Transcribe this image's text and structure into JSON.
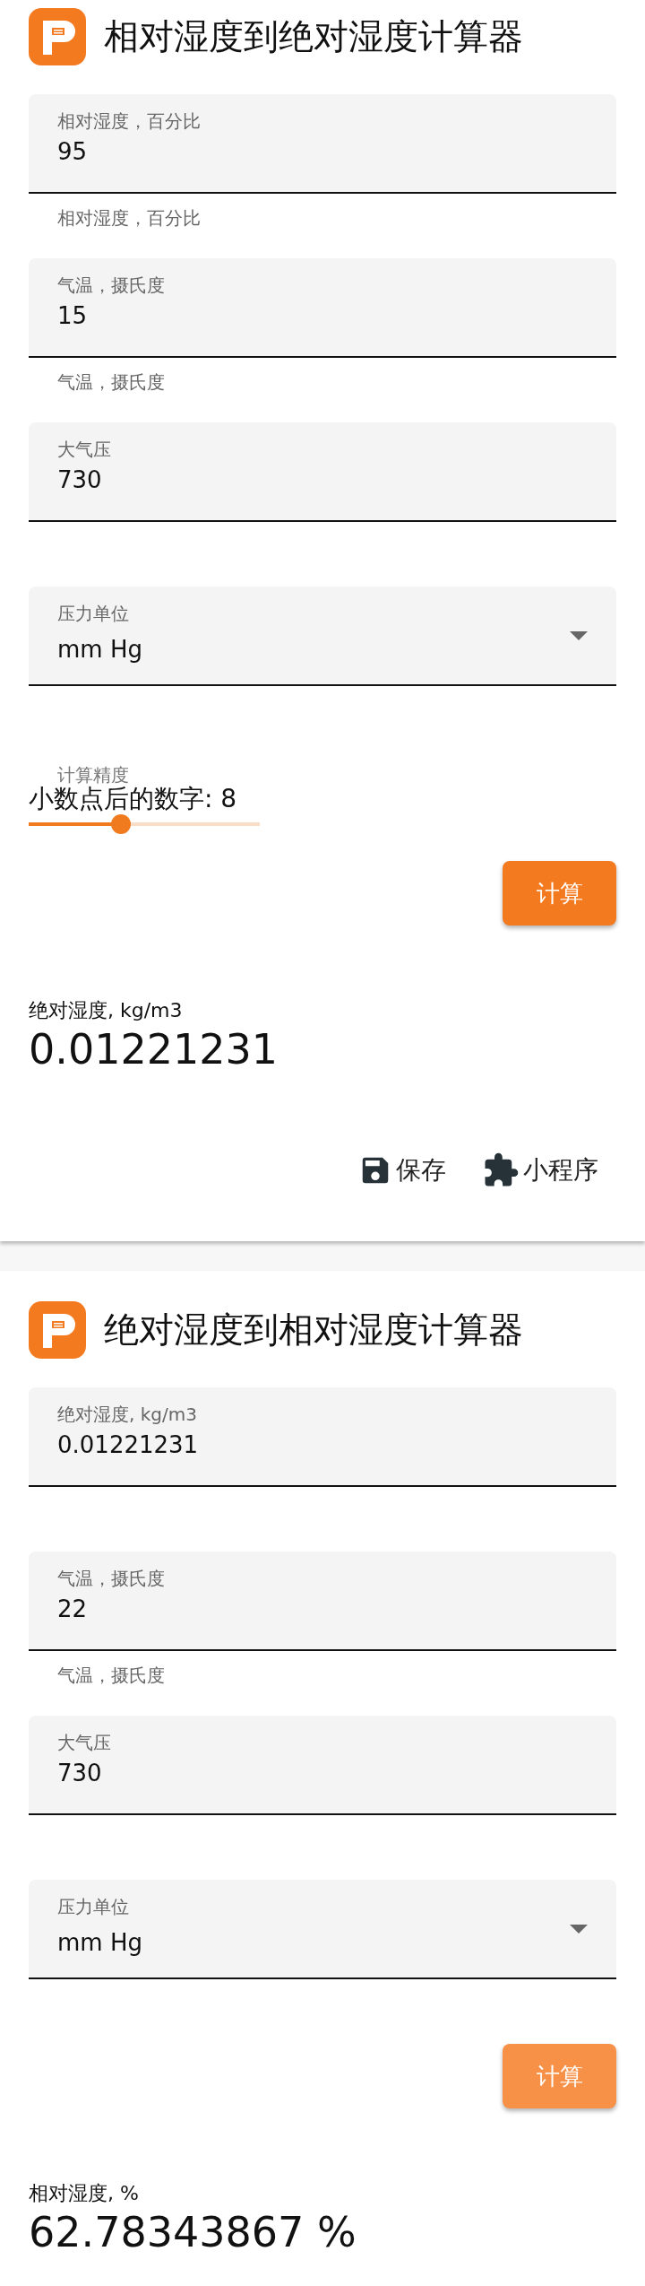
{
  "cards": [
    {
      "title": "相对湿度到绝对湿度计算器",
      "fields": [
        {
          "kind": "text",
          "label": "相对湿度，百分比",
          "value": "95",
          "helper": "相对湿度，百分比"
        },
        {
          "kind": "text",
          "label": "气温，摄氏度",
          "value": "15",
          "helper": "气温，摄氏度"
        },
        {
          "kind": "text",
          "label": "大气压",
          "value": "730"
        },
        {
          "kind": "select",
          "label": "压力单位",
          "value": "mm Hg"
        }
      ],
      "slider": {
        "label": "计算精度",
        "text": "小数点后的数字: 8",
        "level": 0.4
      },
      "button": {
        "label": "计算",
        "disabled": false
      },
      "result": {
        "label": "绝对湿度, kg/m3",
        "value": "0.01221231"
      },
      "actions": [
        {
          "kind": "save",
          "label": "保存"
        },
        {
          "kind": "plugin",
          "label": "小程序"
        }
      ]
    },
    {
      "title": "绝对湿度到相对湿度计算器",
      "fields": [
        {
          "kind": "text",
          "label": "绝对湿度, kg/m3",
          "value": "0.01221231"
        },
        {
          "kind": "text",
          "label": "气温，摄氏度",
          "value": "22",
          "helper": "气温，摄氏度"
        },
        {
          "kind": "text",
          "label": "大气压",
          "value": "730"
        },
        {
          "kind": "select",
          "label": "压力单位",
          "value": "mm Hg"
        }
      ],
      "button": {
        "label": "计算",
        "disabled": true
      },
      "result": {
        "label": "相对湿度, %",
        "value": "62.78343867 %"
      }
    }
  ]
}
